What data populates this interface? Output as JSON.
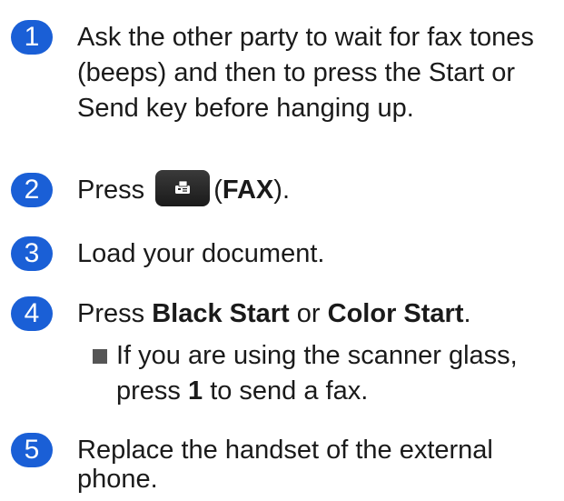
{
  "steps": [
    {
      "number": "1",
      "lines": [
        "Ask the other party to wait for fax tones",
        "(beeps) and then to press the Start or",
        "Send key before hanging up."
      ]
    },
    {
      "number": "2",
      "pre": "Press",
      "paren_open": "(",
      "bold": "FAX",
      "post": ")."
    },
    {
      "number": "3",
      "text": "Load your document."
    },
    {
      "number": "4",
      "pre": "Press",
      "bold1": "Black Start",
      "mid": "or",
      "bold2": "Color Start",
      "post": ".",
      "sub": {
        "line1": "If you are using the scanner glass,",
        "pre": "press",
        "bold": "1",
        "post": "to send a fax."
      }
    },
    {
      "number": "5",
      "lines": [
        "Replace the handset of the external",
        "phone."
      ]
    }
  ],
  "colors": {
    "badge": "#1a5fd6",
    "text": "#1a1a1a",
    "button": "#222222"
  },
  "icons": {
    "fax_button": "fax-icon"
  }
}
